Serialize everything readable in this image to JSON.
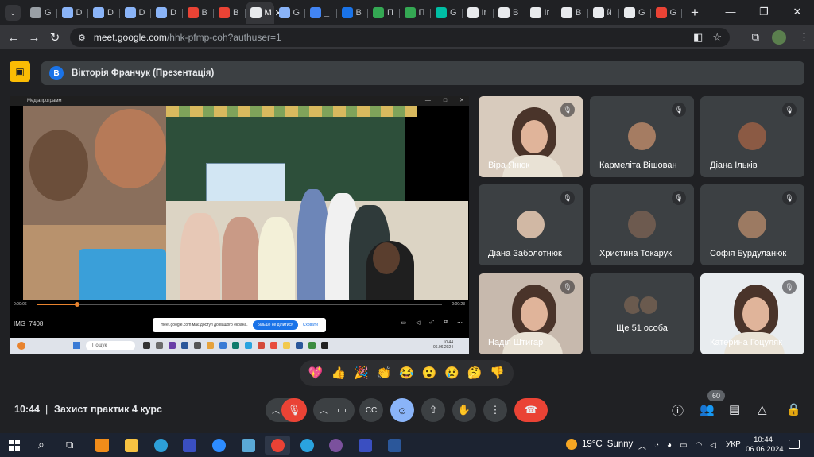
{
  "browser": {
    "tab_labels": [
      "G",
      "D",
      "D",
      "D",
      "D",
      "B",
      "B",
      "M",
      "G",
      "_",
      "B",
      "П",
      "П",
      "G",
      "Ir",
      "B",
      "Ir",
      "B",
      "й",
      "G",
      "G"
    ],
    "active_tab_index": 7,
    "url_host": "meet.google.com",
    "url_path": "/hhk-pfmp-coh?authuser=1"
  },
  "presentation": {
    "presenter_initial": "В",
    "presenter_label": "Вікторія Франчук (Презентація)",
    "media_player_title": "Медіапрограмм",
    "file_name": "IMG_7408",
    "time_elapsed": "0:00:06",
    "time_total": "0:00:23",
    "progress": 0.1,
    "share_toast": "meet.google.com має доступ до вашого екрана.",
    "share_stop": "Більше не ділитися",
    "share_hide": "Сховати",
    "inner_search": "Пошук",
    "inner_clock_time": "10:44",
    "inner_clock_date": "06.06.2024"
  },
  "participants": [
    {
      "name": "Віра Янюк",
      "muted": true,
      "type": "video"
    },
    {
      "name": "Кармеліта Вішован",
      "muted": true,
      "type": "avatar"
    },
    {
      "name": "Діана Ільків",
      "muted": true,
      "type": "avatar"
    },
    {
      "name": "Діана Заболотнюк",
      "muted": true,
      "type": "avatar"
    },
    {
      "name": "Христина Токарук",
      "muted": true,
      "type": "avatar"
    },
    {
      "name": "Софія Бурдуланюк",
      "muted": true,
      "type": "avatar"
    },
    {
      "name": "Надія Штигар",
      "muted": true,
      "type": "video"
    },
    {
      "name": "Ще 51 особа",
      "muted": false,
      "type": "more"
    },
    {
      "name": "Катерина Гоцуляк",
      "muted": true,
      "type": "video"
    }
  ],
  "reactions": [
    "💖",
    "👍",
    "🎉",
    "👏",
    "😂",
    "😮",
    "😢",
    "🤔",
    "👎"
  ],
  "meeting": {
    "time": "10:44",
    "separator": "|",
    "name": "Захист практик 4 курс",
    "participant_count": "60"
  },
  "taskbar": {
    "weather_temp": "19°C",
    "weather_text": "Sunny",
    "lang": "УКР",
    "time": "10:44",
    "date": "06.06.2024"
  }
}
